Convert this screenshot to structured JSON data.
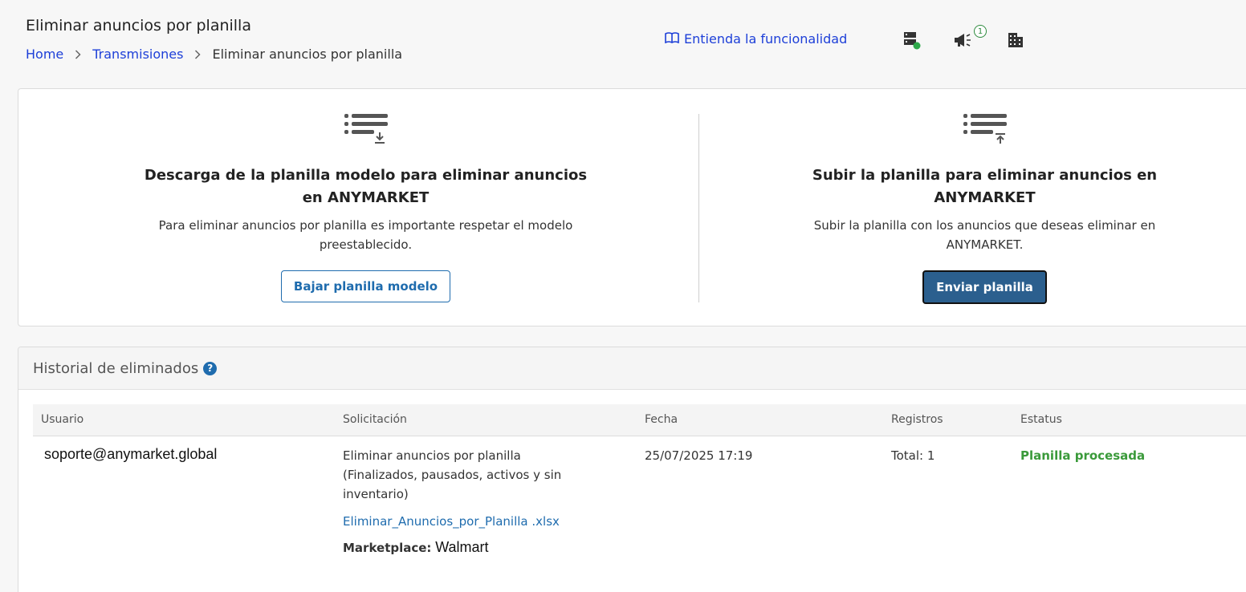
{
  "header": {
    "title": "Eliminar anuncios por planilla",
    "breadcrumb": [
      "Home",
      "Transmisiones",
      "Eliminar anuncios por planilla"
    ],
    "help_link": "Entienda la funcionalidad",
    "notification_count": "1"
  },
  "download": {
    "title_line1": "Descarga de la planilla modelo para eliminar anuncios",
    "title_line2": "en ANYMARKET",
    "desc_line1": "Para eliminar anuncios por planilla es importante respetar el modelo",
    "desc_line2": "preestablecido.",
    "button": "Bajar planilla modelo"
  },
  "upload": {
    "title_line1": "Subir la planilla para eliminar anuncios en",
    "title_line2": "ANYMARKET",
    "desc_line1": "Subir la planilla con los anuncios que deseas eliminar en",
    "desc_line2": "ANYMARKET.",
    "button": "Enviar planilla"
  },
  "history": {
    "title": "Historial de eliminados",
    "columns": [
      "Usuario",
      "Solicitación",
      "Fecha",
      "Registros",
      "Estatus"
    ],
    "rows": [
      {
        "user": "soporte@anymarket.global",
        "request_line1": "Eliminar anuncios por planilla",
        "request_line2": "(Finalizados, pausados, activos y sin",
        "request_line3": "inventario)",
        "file": "Eliminar_Anuncios_por_Planilla .xlsx",
        "marketplace_label": "Marketplace:",
        "marketplace_value": "Walmart",
        "date": "25/07/2025 17:19",
        "records": "Total: 1",
        "status": "Planilla procesada"
      }
    ]
  },
  "colors": {
    "link": "#1d3fd8",
    "primary": "#2b5f8e",
    "success": "#3a9a3a"
  }
}
